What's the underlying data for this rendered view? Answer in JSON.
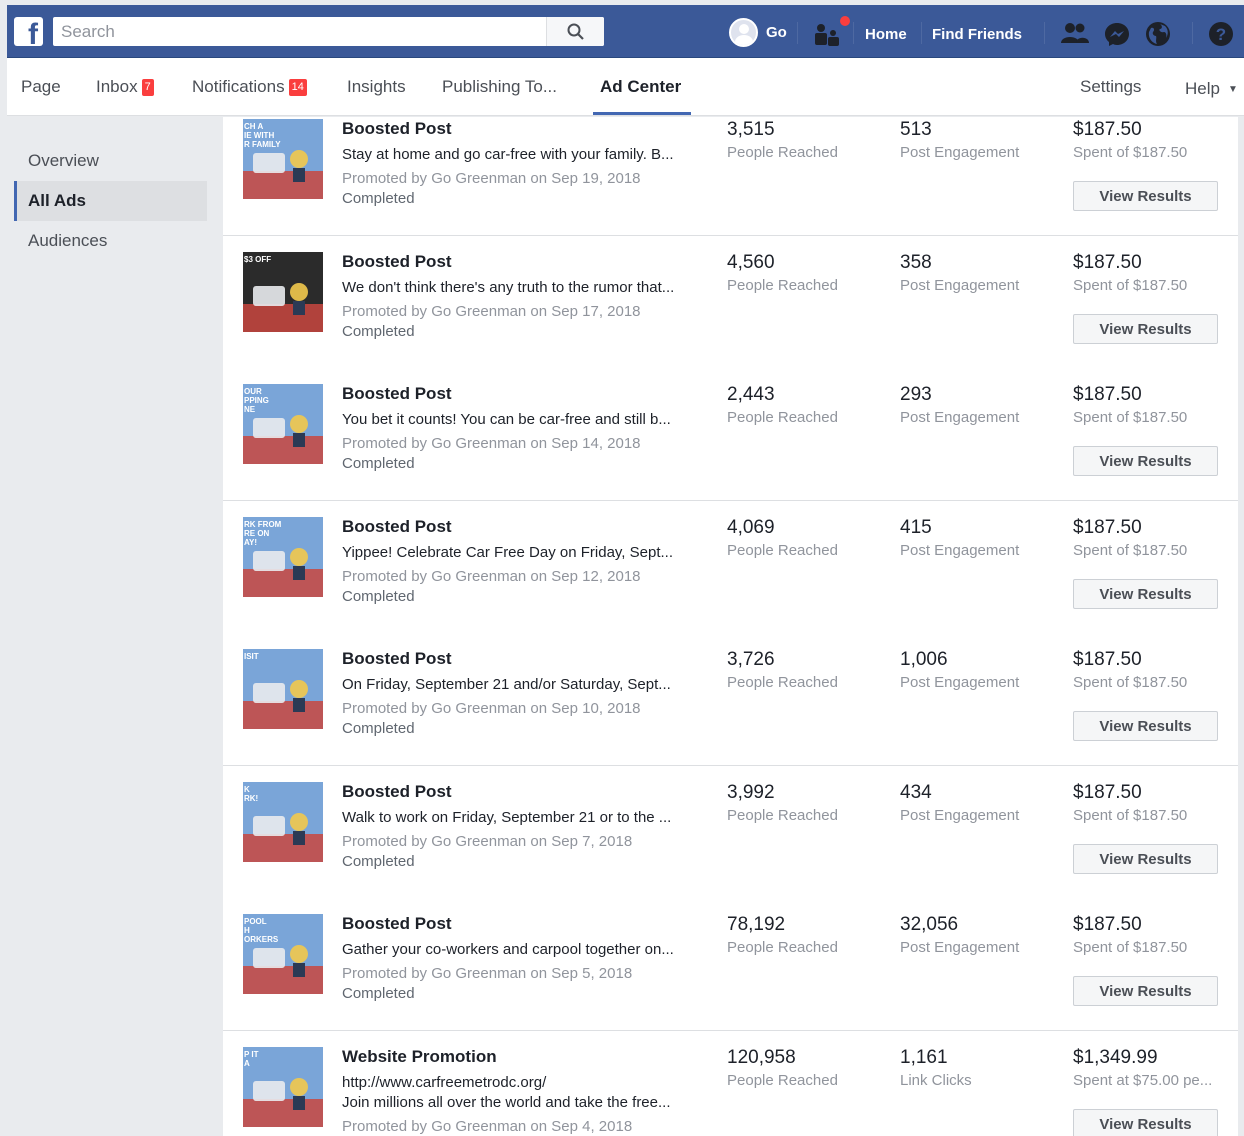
{
  "topbar": {
    "search_placeholder": "Search",
    "user_name": "Go",
    "home": "Home",
    "find_friends": "Find Friends"
  },
  "pagenav": {
    "tabs": [
      {
        "label": "Page"
      },
      {
        "label": "Inbox",
        "badge": "7"
      },
      {
        "label": "Notifications",
        "badge": "14"
      },
      {
        "label": "Insights"
      },
      {
        "label": "Publishing To..."
      },
      {
        "label": "Ad Center"
      }
    ],
    "settings": "Settings",
    "help": "Help"
  },
  "sidebar": {
    "items": [
      {
        "label": "Overview"
      },
      {
        "label": "All Ads"
      },
      {
        "label": "Audiences"
      }
    ]
  },
  "ads": [
    {
      "type": "Boosted Post",
      "desc": "Stay at home and go car-free with your family. B...",
      "promoted": "Promoted by Go Greenman on Sep 19, 2018",
      "status": "Completed",
      "reach": "3,515",
      "reach_label": "People Reached",
      "eng": "513",
      "eng_label": "Post Engagement",
      "spent": "$187.50",
      "spent_label": "Spent of $187.50",
      "button": "View Results",
      "thumb_text": "CH A\nIE WITH\nR FAMILY",
      "thumb_bg": "#7aa5d8"
    },
    {
      "type": "Boosted Post",
      "desc": "We don't think there's any truth to the rumor that...",
      "promoted": "Promoted by Go Greenman on Sep 17, 2018",
      "status": "Completed",
      "reach": "4,560",
      "reach_label": "People Reached",
      "eng": "358",
      "eng_label": "Post Engagement",
      "spent": "$187.50",
      "spent_label": "Spent of $187.50",
      "button": "View Results",
      "thumb_text": "$3 OFF",
      "thumb_bg": "#2b2b2b"
    },
    {
      "type": "Boosted Post",
      "desc": "You bet it counts! You can be car-free and still b...",
      "promoted": "Promoted by Go Greenman on Sep 14, 2018",
      "status": "Completed",
      "reach": "2,443",
      "reach_label": "People Reached",
      "eng": "293",
      "eng_label": "Post Engagement",
      "spent": "$187.50",
      "spent_label": "Spent of $187.50",
      "button": "View Results",
      "thumb_text": "OUR\nPPING\nNE",
      "thumb_bg": "#7aa5d8"
    },
    {
      "type": "Boosted Post",
      "desc": "Yippee! Celebrate Car Free Day on Friday, Sept...",
      "promoted": "Promoted by Go Greenman on Sep 12, 2018",
      "status": "Completed",
      "reach": "4,069",
      "reach_label": "People Reached",
      "eng": "415",
      "eng_label": "Post Engagement",
      "spent": "$187.50",
      "spent_label": "Spent of $187.50",
      "button": "View Results",
      "thumb_text": "RK FROM\nRE ON\nAY!",
      "thumb_bg": "#7aa5d8"
    },
    {
      "type": "Boosted Post",
      "desc": "On Friday, September 21 and/or Saturday, Sept...",
      "promoted": "Promoted by Go Greenman on Sep 10, 2018",
      "status": "Completed",
      "reach": "3,726",
      "reach_label": "People Reached",
      "eng": "1,006",
      "eng_label": "Post Engagement",
      "spent": "$187.50",
      "spent_label": "Spent of $187.50",
      "button": "View Results",
      "thumb_text": "ISIT",
      "thumb_bg": "#7aa5d8"
    },
    {
      "type": "Boosted Post",
      "desc": "Walk to work on Friday, September 21 or to the ...",
      "promoted": "Promoted by Go Greenman on Sep 7, 2018",
      "status": "Completed",
      "reach": "3,992",
      "reach_label": "People Reached",
      "eng": "434",
      "eng_label": "Post Engagement",
      "spent": "$187.50",
      "spent_label": "Spent of $187.50",
      "button": "View Results",
      "thumb_text": "K\nRK!",
      "thumb_bg": "#7aa5d8"
    },
    {
      "type": "Boosted Post",
      "desc": "Gather your co-workers and carpool together on...",
      "promoted": "Promoted by Go Greenman on Sep 5, 2018",
      "status": "Completed",
      "reach": "78,192",
      "reach_label": "People Reached",
      "eng": "32,056",
      "eng_label": "Post Engagement",
      "spent": "$187.50",
      "spent_label": "Spent of $187.50",
      "button": "View Results",
      "thumb_text": "POOL\nH\nORKERS",
      "thumb_bg": "#7aa5d8"
    },
    {
      "type": "Website Promotion",
      "desc": "http://www.carfreemetrodc.org/",
      "desc2": "Join millions all over the world and take the free...",
      "promoted": "Promoted by Go Greenman on Sep 4, 2018",
      "status": "",
      "reach": "120,958",
      "reach_label": "People Reached",
      "eng": "1,161",
      "eng_label": "Link Clicks",
      "spent": "$1,349.99",
      "spent_label": "Spent at $75.00 pe...",
      "button": "View Results",
      "thumb_text": "P IT\nA",
      "thumb_bg": "#7aa5d8"
    }
  ],
  "colors": {
    "fb_blue": "#3b5998",
    "accent": "#4267b2",
    "badge_red": "#fa3e3e"
  }
}
